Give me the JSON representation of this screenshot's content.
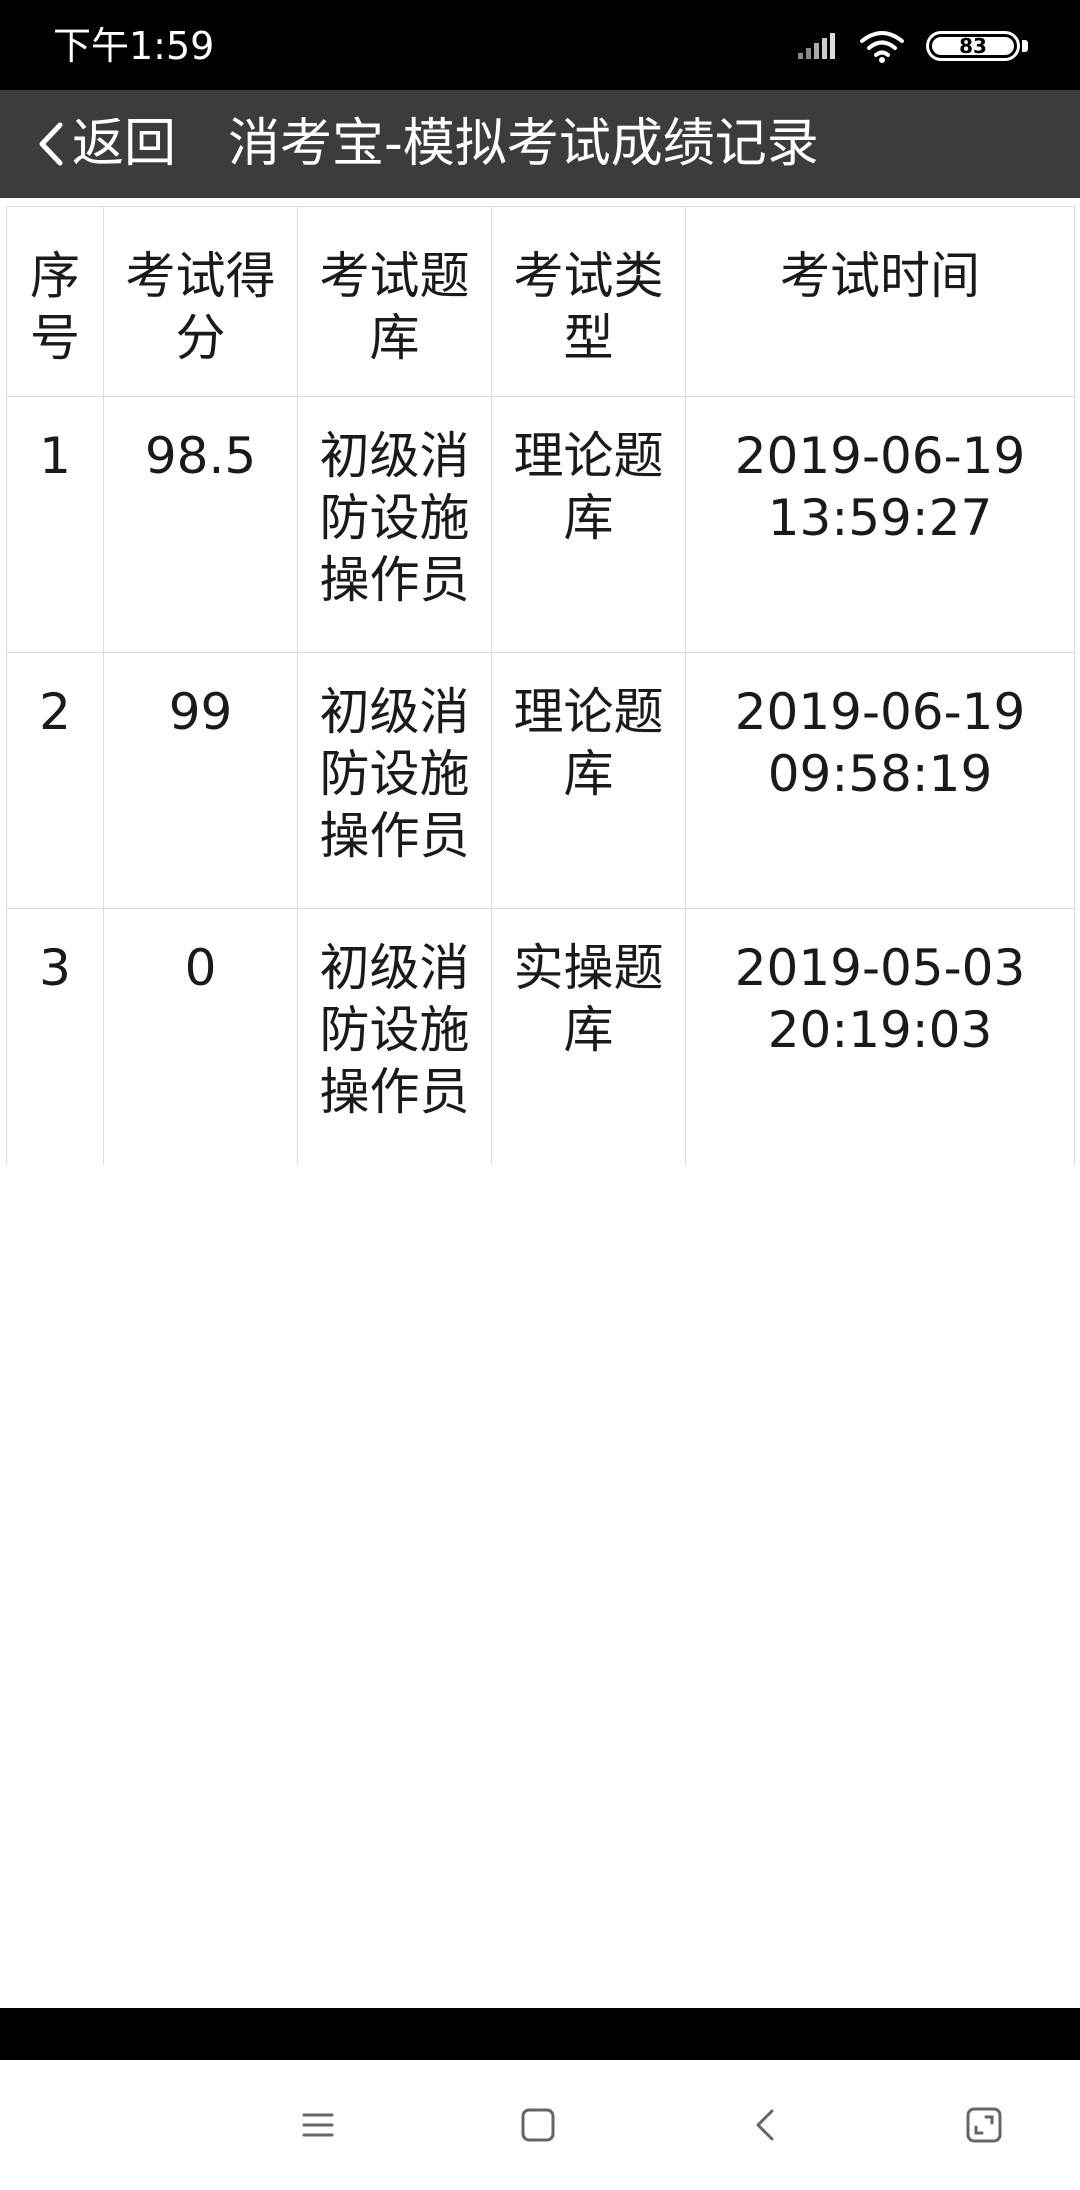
{
  "status_bar": {
    "time": "下午1:59",
    "battery": "83",
    "icons": [
      "signal-icon",
      "wifi-icon",
      "battery-icon"
    ]
  },
  "header": {
    "back_label": "返回",
    "title": "消考宝-模拟考试成绩记录",
    "background": "#3c3c3c"
  },
  "table": {
    "columns": [
      "序号",
      "考试得分",
      "考试题库",
      "考试类型",
      "考试时间"
    ],
    "rows": [
      {
        "no": "1",
        "score": "98.5",
        "bank": "初级消防设施操作员",
        "type": "理论题库",
        "time": "2019-06-19\n13:59:27"
      },
      {
        "no": "2",
        "score": "99",
        "bank": "初级消防设施操作员",
        "type": "理论题库",
        "time": "2019-06-19\n09:58:19"
      },
      {
        "no": "3",
        "score": "0",
        "bank": "初级消防设施操作员",
        "type": "实操题库",
        "time": "2019-05-03\n20:19:03"
      }
    ]
  },
  "nav": {
    "buttons": [
      "menu-icon",
      "home-icon",
      "back-icon",
      "recents-icon"
    ]
  }
}
